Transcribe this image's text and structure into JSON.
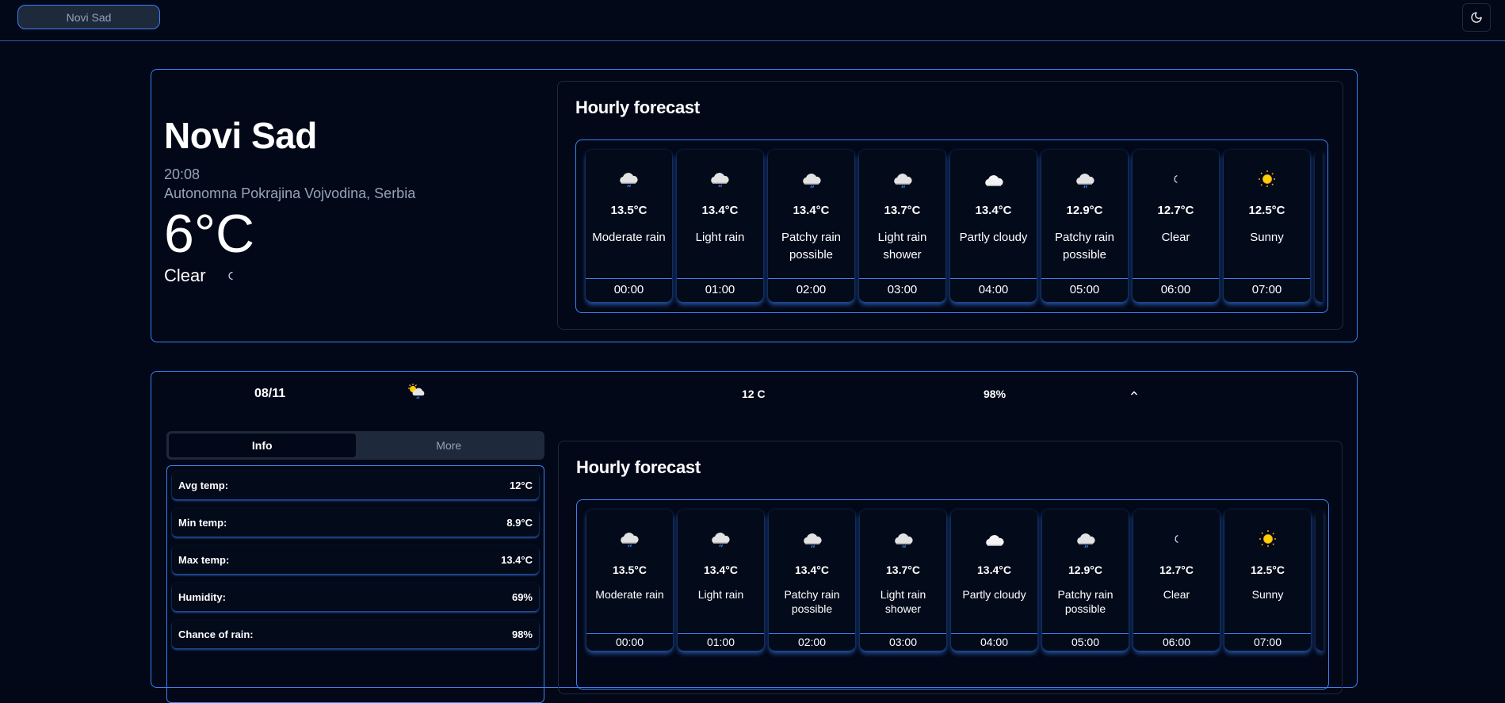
{
  "topbar": {
    "city_button": "Novi Sad",
    "theme_icon": "moon-icon"
  },
  "current": {
    "city": "Novi Sad",
    "time": "20:08",
    "region": "Autonomna Pokrajina Vojvodina, Serbia",
    "temperature": "6°C",
    "condition": "Clear",
    "condition_icon": "moon-icon"
  },
  "hourly_title": "Hourly forecast",
  "hourly": [
    {
      "temp": "13.5°C",
      "desc": "Moderate rain",
      "time": "00:00",
      "icon": "rain-cloud"
    },
    {
      "temp": "13.4°C",
      "desc": "Light rain",
      "time": "01:00",
      "icon": "rain-cloud"
    },
    {
      "temp": "13.4°C",
      "desc": "Patchy rain possible",
      "time": "02:00",
      "icon": "moon-rain-cloud"
    },
    {
      "temp": "13.7°C",
      "desc": "Light rain shower",
      "time": "03:00",
      "icon": "moon-rain-cloud"
    },
    {
      "temp": "13.4°C",
      "desc": "Partly cloudy",
      "time": "04:00",
      "icon": "moon-cloud"
    },
    {
      "temp": "12.9°C",
      "desc": "Patchy rain possible",
      "time": "05:00",
      "icon": "moon-rain-cloud"
    },
    {
      "temp": "12.7°C",
      "desc": "Clear",
      "time": "06:00",
      "icon": "moon"
    },
    {
      "temp": "12.5°C",
      "desc": "Sunny",
      "time": "07:00",
      "icon": "sun"
    }
  ],
  "day": {
    "date": "08/11",
    "icon": "sun-rain-cloud",
    "avg_temp": "12 C",
    "chance_of_rain": "98%",
    "expanded_icon": "chevron-up-icon",
    "tabs": [
      {
        "label": "Info",
        "active": true
      },
      {
        "label": "More",
        "active": false
      }
    ],
    "info": [
      {
        "label": "Avg temp:",
        "value": "12°C"
      },
      {
        "label": "Min temp:",
        "value": "8.9°C"
      },
      {
        "label": "Max temp:",
        "value": "13.4°C"
      },
      {
        "label": "Humidity:",
        "value": "69%"
      },
      {
        "label": "Chance of rain:",
        "value": "98%"
      }
    ]
  },
  "colors": {
    "background": "#020817",
    "accent": "#3b82f6",
    "muted_text": "#94a3b8",
    "panel": "#1e293b"
  }
}
